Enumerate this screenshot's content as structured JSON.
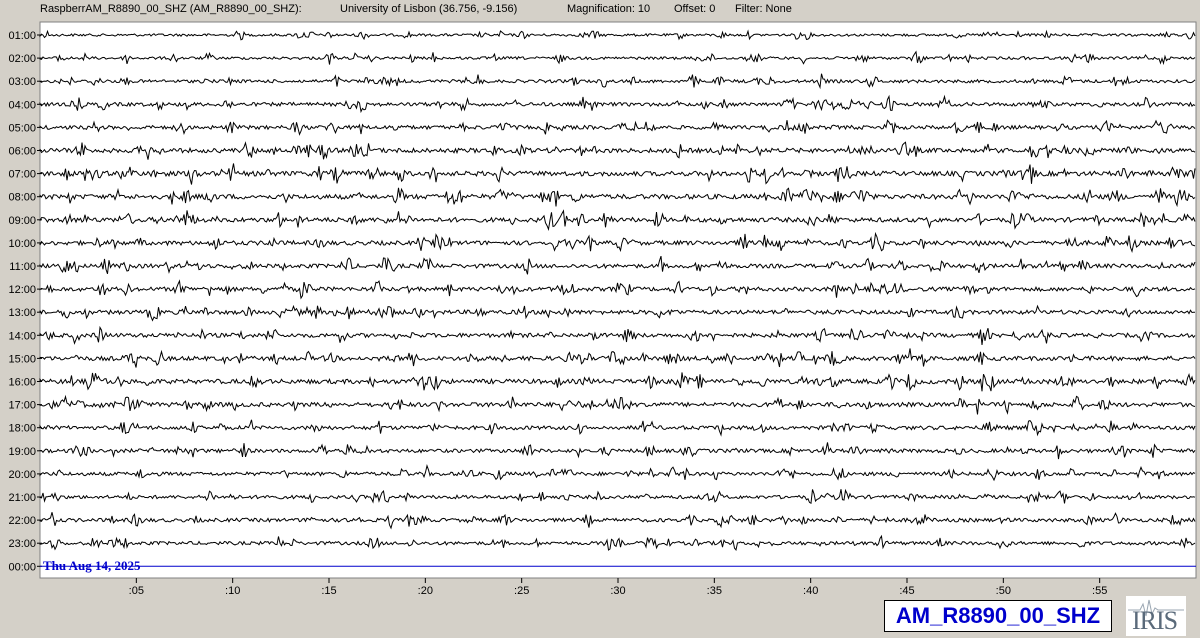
{
  "header": {
    "station": "RaspberrAM_R8890_00_SHZ (AM_R8890_00_SHZ):",
    "location": "University of Lisbon (36.756, -9.156)",
    "magnification": "Magnification: 10",
    "offset": "Offset: 0",
    "filter": "Filter: None"
  },
  "date_label": "Thu Aug 14, 2025",
  "station_label": "AM_R8890_00_SHZ",
  "logo_text": "IRIS",
  "colors": {
    "trace": "#000000",
    "date": "#0000cc",
    "station": "#0000cc",
    "background": "#d4d0c8",
    "plot": "#ffffff"
  },
  "chart_data": {
    "type": "line",
    "rows": [
      "01:00",
      "02:00",
      "03:00",
      "04:00",
      "05:00",
      "06:00",
      "07:00",
      "08:00",
      "09:00",
      "10:00",
      "11:00",
      "12:00",
      "13:00",
      "14:00",
      "15:00",
      "16:00",
      "17:00",
      "18:00",
      "19:00",
      "20:00",
      "21:00",
      "22:00",
      "23:00",
      "00:00"
    ],
    "x_ticks": [
      ":05",
      ":10",
      ":15",
      ":20",
      ":25",
      ":30",
      ":35",
      ":40",
      ":45",
      ":50",
      ":55"
    ],
    "x_tick_minutes": [
      5,
      10,
      15,
      20,
      25,
      30,
      35,
      40,
      45,
      50,
      55
    ],
    "x_range_minutes": [
      0,
      60
    ],
    "row_amplitude": [
      0.3,
      0.35,
      0.45,
      0.55,
      0.6,
      0.75,
      0.8,
      0.8,
      0.75,
      0.7,
      0.65,
      0.65,
      0.65,
      0.65,
      0.7,
      0.75,
      0.7,
      0.6,
      0.55,
      0.55,
      0.5,
      0.55,
      0.5,
      0
    ]
  }
}
